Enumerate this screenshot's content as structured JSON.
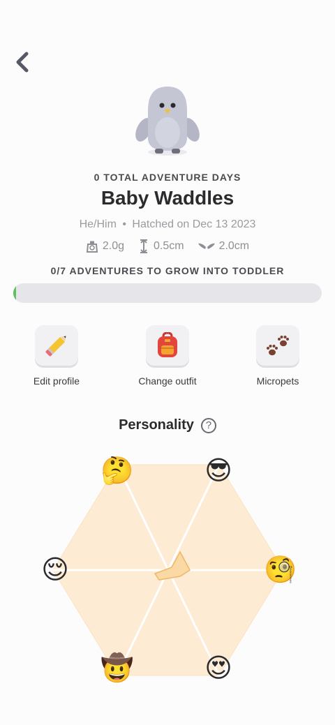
{
  "header": {
    "back_icon": "chevron-left-icon"
  },
  "pet": {
    "total_days": "0 TOTAL ADVENTURE DAYS",
    "name": "Baby Waddles",
    "pronouns": "He/Him",
    "hatched": "Hatched on Dec 13 2023",
    "separator": "•",
    "weight": "2.0g",
    "height": "0.5cm",
    "wingspan": "2.0cm"
  },
  "growth": {
    "label": "0/7 ADVENTURES TO GROW INTO TODDLER",
    "completed": 0,
    "total": 7,
    "colors": {
      "fill": "#5bc35b",
      "track": "#e6e6ea"
    }
  },
  "actions": [
    {
      "label": "Edit profile",
      "icon": "pencil-icon"
    },
    {
      "label": "Change outfit",
      "icon": "backpack-icon"
    },
    {
      "label": "Micropets",
      "icon": "paw-prints-icon"
    }
  ],
  "personality": {
    "title": "Personality",
    "help": "?",
    "traits": [
      {
        "emoji": "🤔",
        "icon": "thinking-face-icon"
      },
      {
        "emoji": "😎",
        "icon": "sunglasses-face-icon"
      },
      {
        "emoji": "🧐",
        "icon": "monocle-face-icon"
      },
      {
        "emoji": "😍",
        "icon": "heart-eyes-face-icon"
      },
      {
        "emoji": "🤠",
        "icon": "cowboy-face-icon"
      },
      {
        "emoji": "😌",
        "icon": "relieved-face-icon"
      }
    ],
    "colors": {
      "hex_fill": "#fdebd3",
      "lines": "#ffffff",
      "shape_fill": "#fbd9a4",
      "shape_stroke": "#f0b766"
    }
  }
}
